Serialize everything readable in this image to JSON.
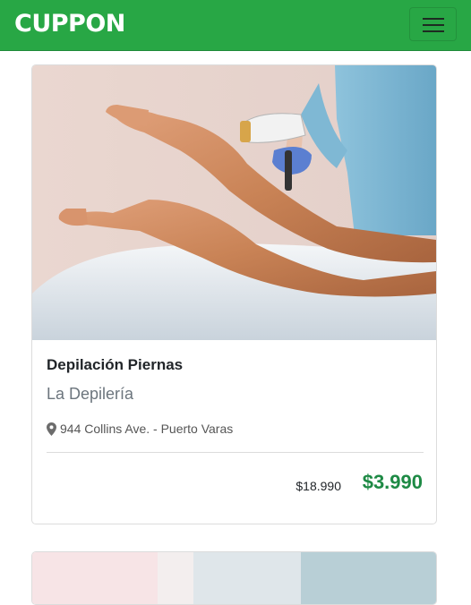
{
  "header": {
    "brand": "CUPPON",
    "menu_icon": "hamburger-menu-icon"
  },
  "deal": {
    "title": "Depilación Piernas",
    "merchant": "La Depilería",
    "location_icon": "map-marker-icon",
    "address": "944 Collins Ave. - Puerto Varas",
    "original_price": "$18.990",
    "price": "$3.990"
  },
  "colors": {
    "navbar": "#28a745",
    "price": "#1e8a45",
    "subtitle": "#6c757d"
  }
}
